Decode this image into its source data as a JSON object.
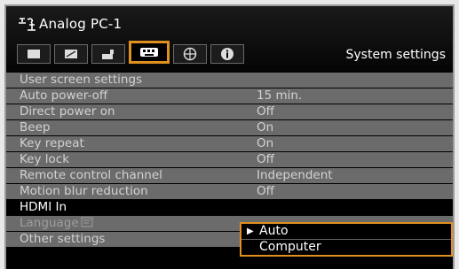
{
  "header": {
    "source_name": "Analog PC-1",
    "section_title": "System settings"
  },
  "tabs": [
    {
      "icon": "image-quality-icon"
    },
    {
      "icon": "image-adjust-icon"
    },
    {
      "icon": "installation-icon"
    },
    {
      "icon": "system-settings-icon",
      "active": true
    },
    {
      "icon": "network-icon"
    },
    {
      "icon": "info-icon"
    }
  ],
  "menu": {
    "items": [
      {
        "label": "User screen settings",
        "value": ""
      },
      {
        "label": "Auto power-off",
        "value": "15 min."
      },
      {
        "label": "Direct power on",
        "value": "Off"
      },
      {
        "label": "Beep",
        "value": "On"
      },
      {
        "label": "Key repeat",
        "value": "On"
      },
      {
        "label": "Key lock",
        "value": "Off"
      },
      {
        "label": "Remote control channel",
        "value": "Independent"
      },
      {
        "label": "Motion blur reduction",
        "value": "Off"
      },
      {
        "label": "HDMI In",
        "value": ""
      },
      {
        "label": "Language",
        "value": ""
      },
      {
        "label": "Other settings",
        "value": ""
      }
    ]
  },
  "dropdown": {
    "options": [
      "Auto",
      "Computer"
    ],
    "selected": "Auto"
  },
  "colors": {
    "accent": "#e0901e",
    "row_bg": "#6b6b6b",
    "background": "#000000"
  }
}
